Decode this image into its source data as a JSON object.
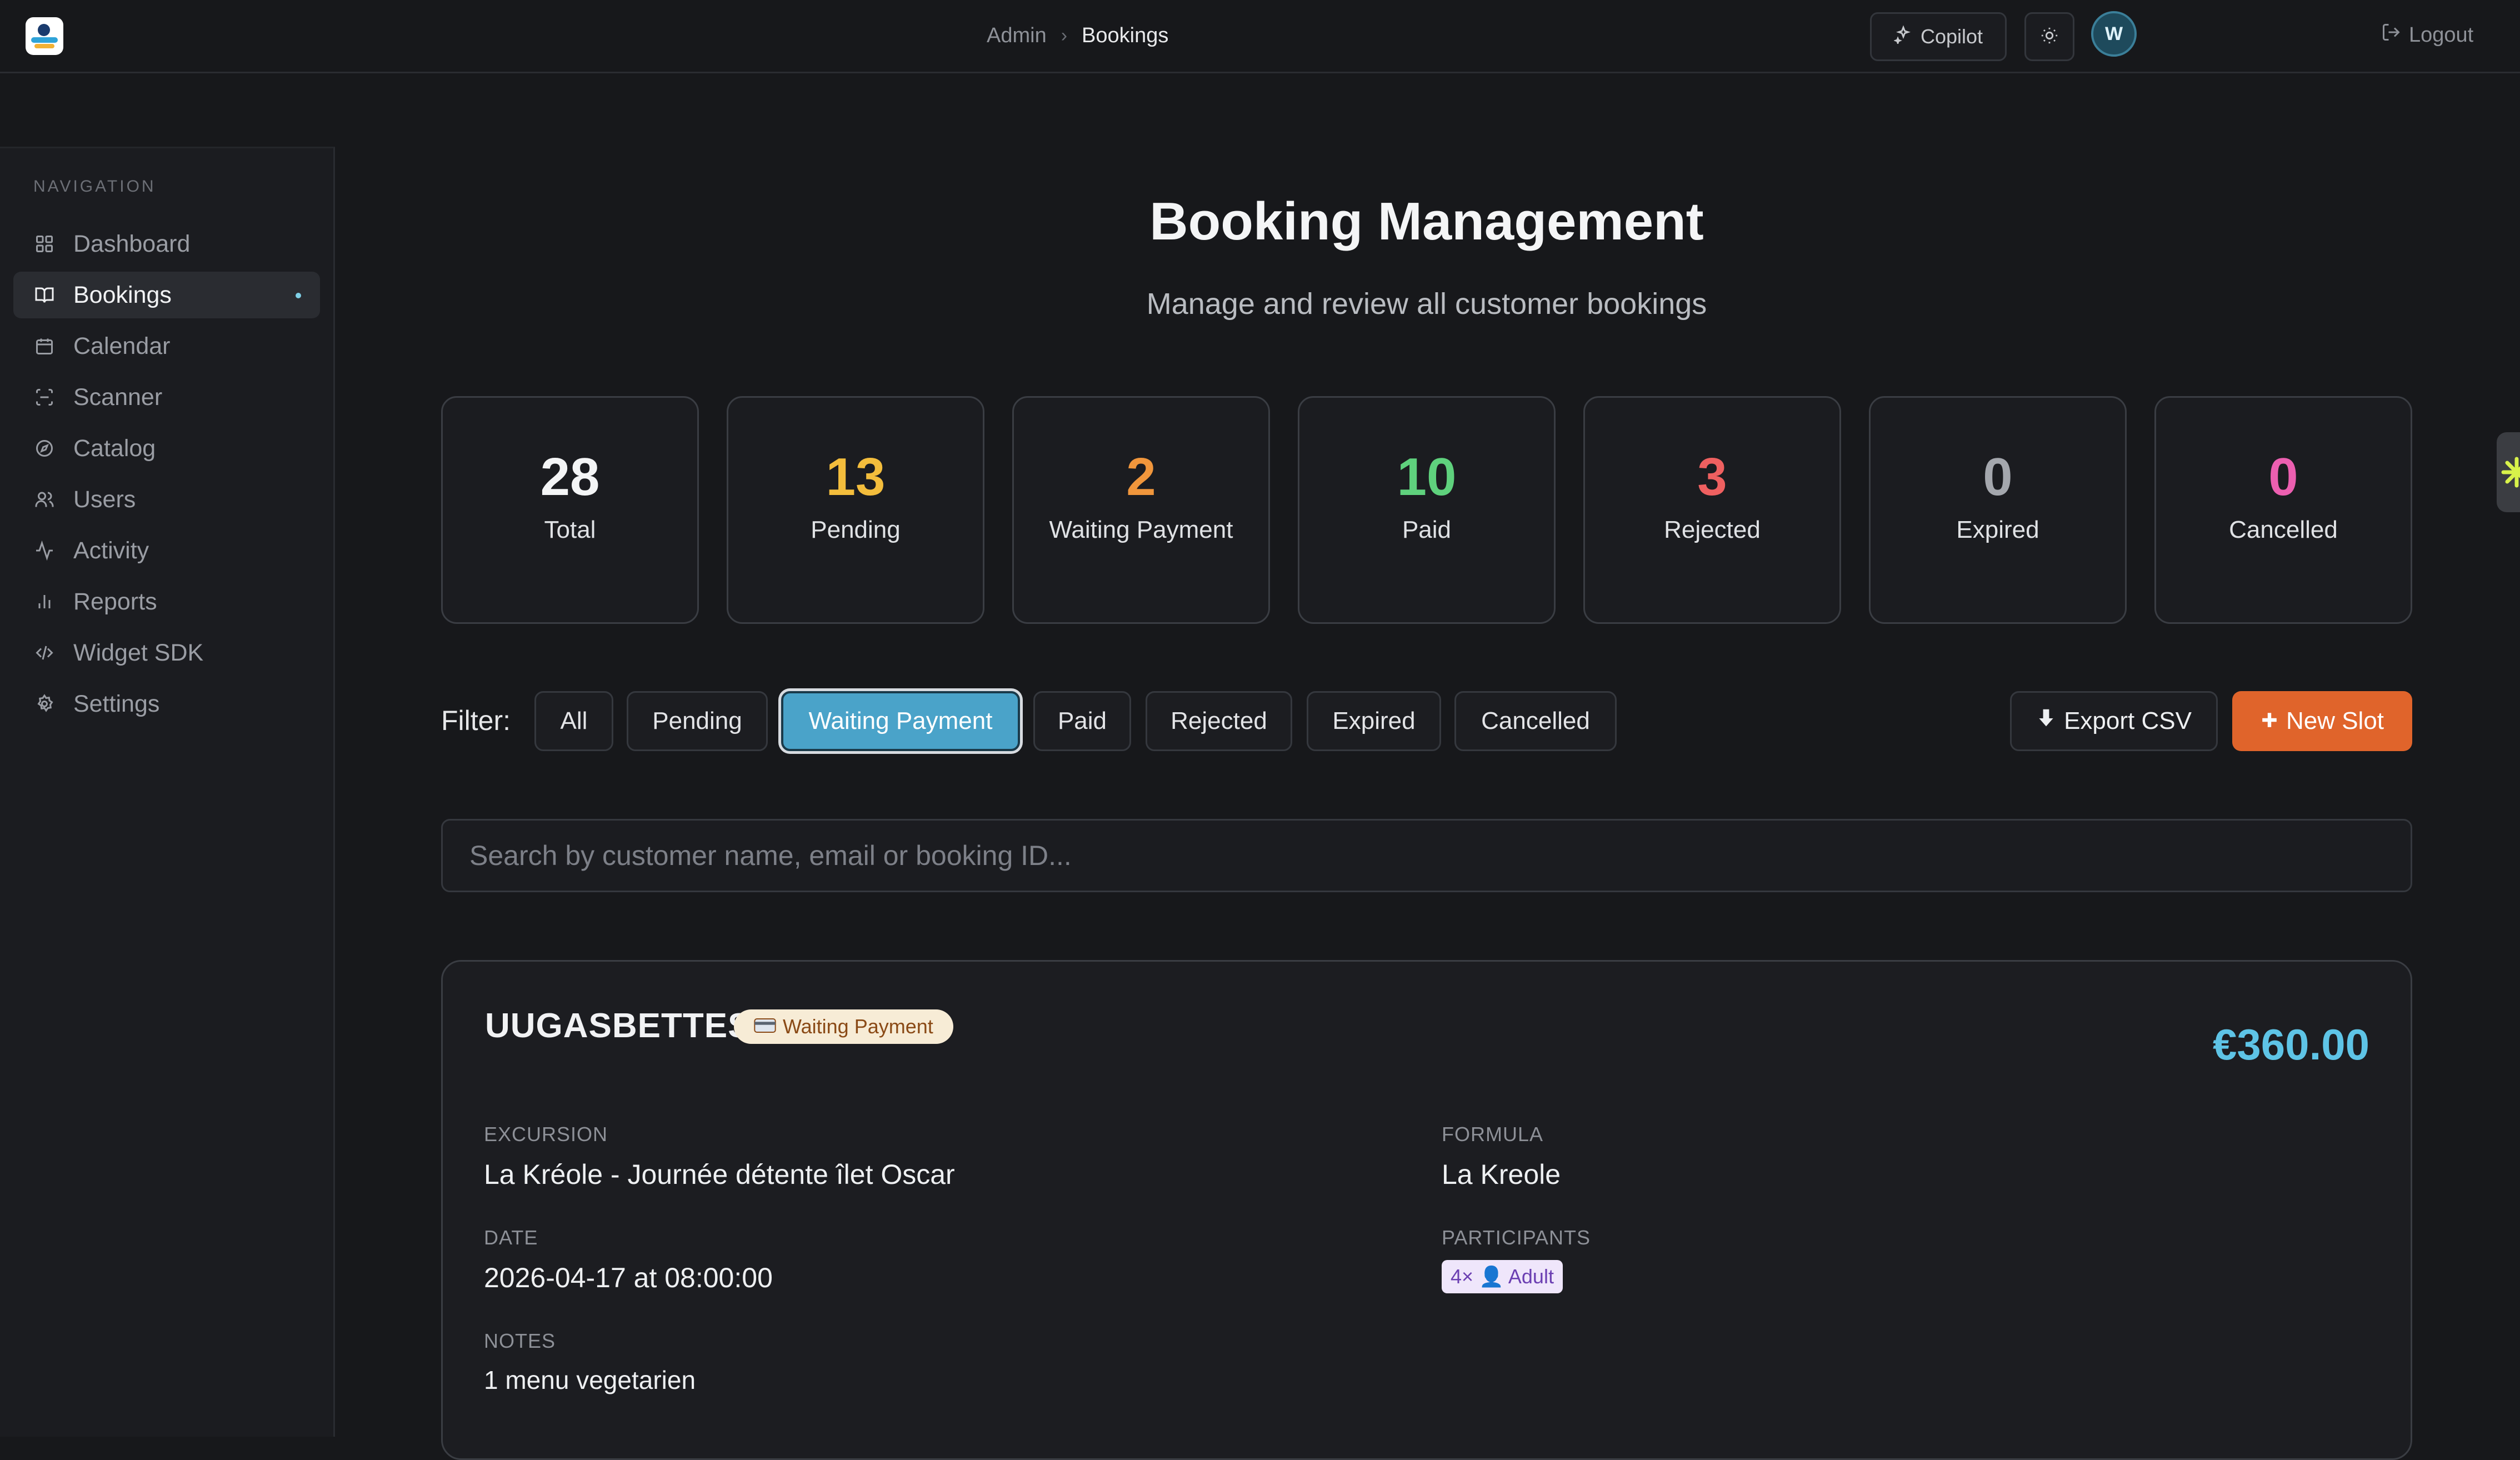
{
  "header": {
    "breadcrumb": {
      "parent": "Admin",
      "current": "Bookings"
    },
    "copilot_label": "Copilot",
    "avatar_initial": "W",
    "username": "",
    "logout_label": "Logout"
  },
  "sidebar": {
    "title": "NAVIGATION",
    "items": [
      {
        "label": "Dashboard",
        "icon": "grid-icon"
      },
      {
        "label": "Bookings",
        "icon": "book-icon",
        "active": true
      },
      {
        "label": "Calendar",
        "icon": "calendar-icon"
      },
      {
        "label": "Scanner",
        "icon": "scan-icon"
      },
      {
        "label": "Catalog",
        "icon": "compass-icon"
      },
      {
        "label": "Users",
        "icon": "users-icon"
      },
      {
        "label": "Activity",
        "icon": "activity-icon"
      },
      {
        "label": "Reports",
        "icon": "bar-chart-icon"
      },
      {
        "label": "Widget SDK",
        "icon": "code-icon"
      },
      {
        "label": "Settings",
        "icon": "gear-icon"
      }
    ]
  },
  "main": {
    "title": "Booking Management",
    "subtitle": "Manage and review all customer bookings",
    "stats": [
      {
        "value": "28",
        "label": "Total",
        "color": "#f4f5f6"
      },
      {
        "value": "13",
        "label": "Pending",
        "color": "#f3bd3c"
      },
      {
        "value": "2",
        "label": "Waiting Payment",
        "color": "#f0963c"
      },
      {
        "value": "10",
        "label": "Paid",
        "color": "#5fd17d"
      },
      {
        "value": "3",
        "label": "Rejected",
        "color": "#ef6060"
      },
      {
        "value": "0",
        "label": "Expired",
        "color": "#a4a7ad"
      },
      {
        "value": "0",
        "label": "Cancelled",
        "color": "#ec5fb0"
      }
    ],
    "filter": {
      "label": "Filter:",
      "options": [
        "All",
        "Pending",
        "Waiting Payment",
        "Paid",
        "Rejected",
        "Expired",
        "Cancelled"
      ],
      "active": "Waiting Payment"
    },
    "actions": {
      "export_label": "Export CSV",
      "new_slot_label": "New Slot"
    },
    "search": {
      "placeholder": "Search by customer name, email or booking ID..."
    },
    "booking": {
      "reference": "UUGASBETTEST",
      "status": "Waiting Payment",
      "price": "€360.00",
      "excursion_label": "EXCURSION",
      "excursion": "La Kréole - Journée détente îlet Oscar",
      "formula_label": "FORMULA",
      "formula": "La Kreole",
      "date_label": "DATE",
      "date": "2026-04-17 at 08:00:00",
      "participants_label": "PARTICIPANTS",
      "participants": "4× 👤 Adult",
      "notes_label": "NOTES",
      "notes": "1 menu vegetarien"
    }
  }
}
